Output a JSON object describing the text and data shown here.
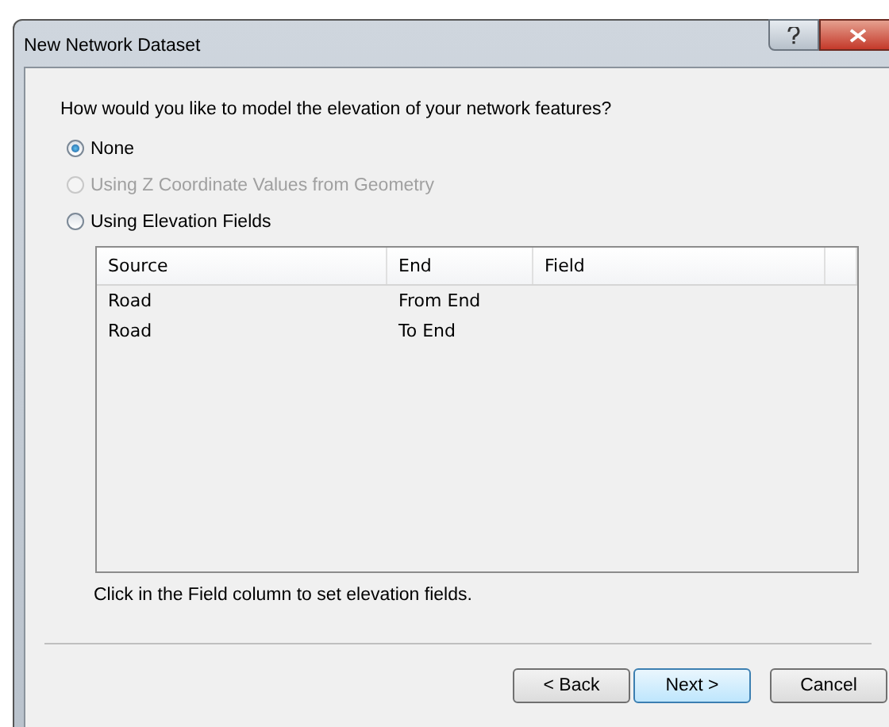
{
  "window": {
    "title": "New Network Dataset"
  },
  "question": "How would you like to model the elevation of your network features?",
  "options": [
    {
      "label": "None",
      "selected": true,
      "disabled": false
    },
    {
      "label": "Using Z Coordinate Values from Geometry",
      "selected": false,
      "disabled": true
    },
    {
      "label": "Using Elevation Fields",
      "selected": false,
      "disabled": false
    }
  ],
  "table": {
    "columns": [
      "Source",
      "End",
      "Field"
    ],
    "rows": [
      {
        "cells": [
          "Road",
          "From End",
          ""
        ]
      },
      {
        "cells": [
          "Road",
          "To End",
          ""
        ]
      }
    ]
  },
  "hint": "Click in the Field column to set elevation fields.",
  "buttons": [
    {
      "label": "< Back",
      "default": false
    },
    {
      "label": "Next >",
      "default": true
    },
    {
      "label": "Cancel",
      "default": false
    }
  ]
}
